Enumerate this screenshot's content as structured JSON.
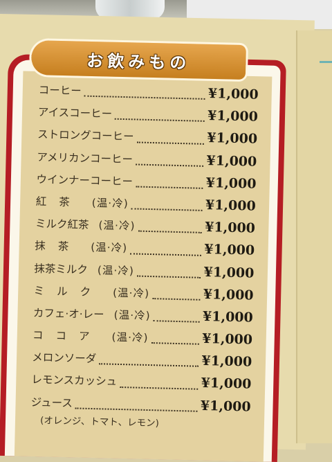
{
  "menu": {
    "title": "お飲みもの",
    "items": [
      {
        "name": "コーヒー",
        "note": "",
        "price": "¥1,000"
      },
      {
        "name": "アイスコーヒー",
        "note": "",
        "price": "¥1,000"
      },
      {
        "name": "ストロングコーヒー",
        "note": "",
        "price": "¥1,000"
      },
      {
        "name": "アメリカンコーヒー",
        "note": "",
        "price": "¥1,000"
      },
      {
        "name": "ウインナーコーヒー",
        "note": "",
        "price": "¥1,000"
      },
      {
        "name": "紅茶",
        "note": "(温·冷)",
        "price": "¥1,000"
      },
      {
        "name": "ミルク紅茶",
        "note": "(温·冷)",
        "price": "¥1,000"
      },
      {
        "name": "抹茶",
        "note": "(温·冷)",
        "price": "¥1,000"
      },
      {
        "name": "抹茶ミルク",
        "note": "(温·冷)",
        "price": "¥1,000"
      },
      {
        "name": "ミルク",
        "note": "(温·冷)",
        "price": "¥1,000"
      },
      {
        "name": "カフェ·オ·レー",
        "note": "(温·冷)",
        "price": "¥1,000"
      },
      {
        "name": "ココア",
        "note": "(温·冷)",
        "price": "¥1,000"
      },
      {
        "name": "メロンソーダ",
        "note": "",
        "price": "¥1,000"
      },
      {
        "name": "レモンスカッシュ",
        "note": "",
        "price": "¥1,000"
      },
      {
        "name": "ジュース",
        "note": "",
        "price": "¥1,000"
      }
    ],
    "juice_varieties": "(オレンジ、トマト、レモン)"
  },
  "colors": {
    "frame_red": "#b51d24",
    "badge_orange": "#d8922f",
    "paper": "#e7dbad",
    "panel": "#e4d2a0"
  }
}
